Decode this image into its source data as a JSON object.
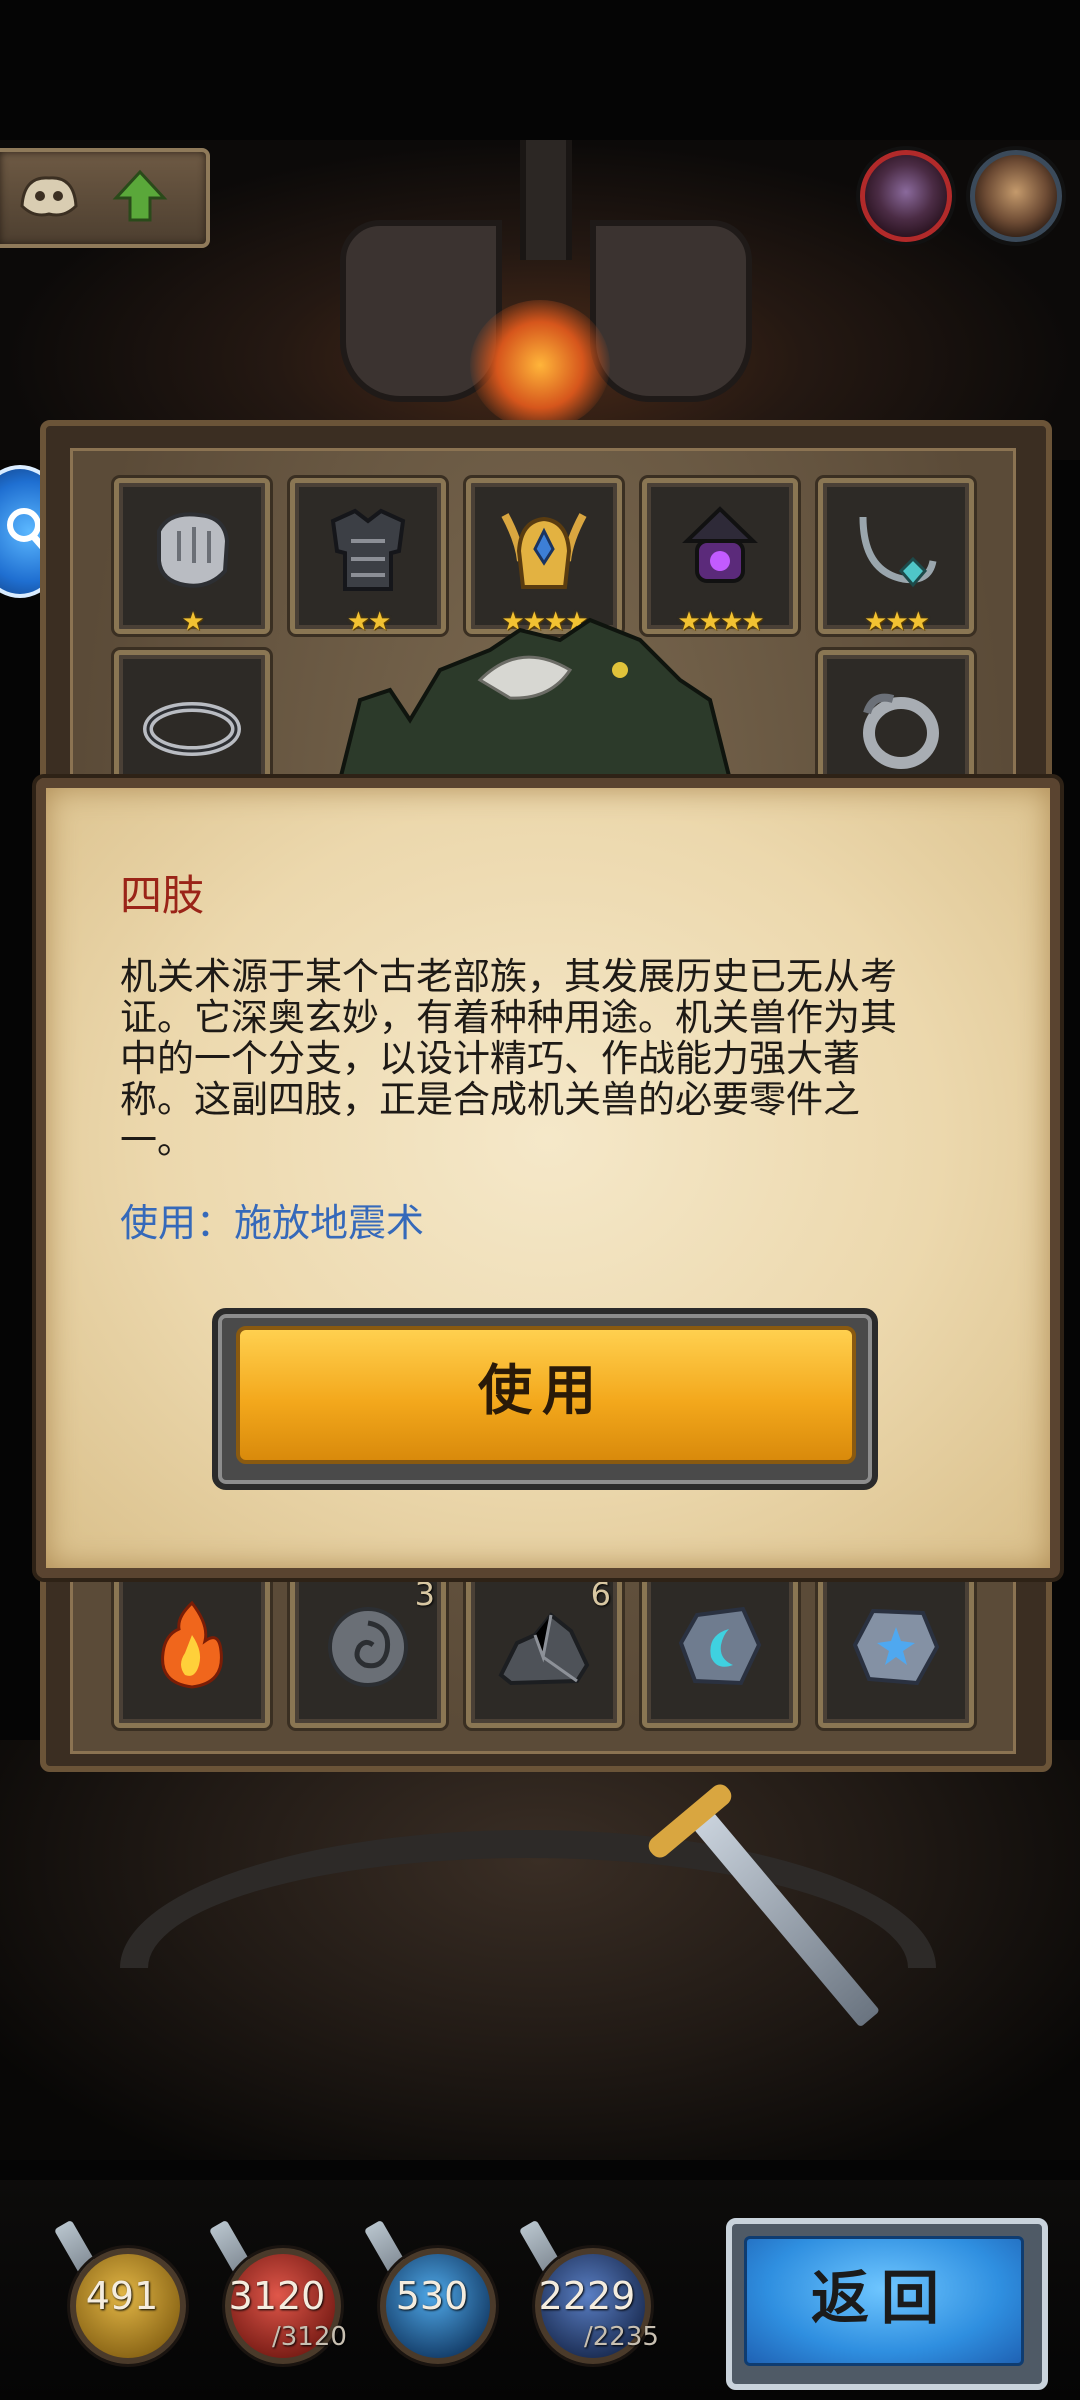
{
  "dialog": {
    "title": "四肢",
    "description": "机关术源于某个古老部族，其发展历史已无从考证。它深奥玄妙，有着种种用途。机关兽作为其中的一个分支，以设计精巧、作战能力强大著称。这副四肢，正是合成机关兽的必要零件之一。",
    "use_text": "使用：施放地震术",
    "use_button": "使用"
  },
  "equipment_row": [
    {
      "icon": "gauntlet-icon",
      "stars": "★"
    },
    {
      "icon": "armor-icon",
      "stars": "★★"
    },
    {
      "icon": "helmet-icon",
      "stars": "★★★★"
    },
    {
      "icon": "lantern-icon",
      "stars": "★★★★"
    },
    {
      "icon": "necklace-icon",
      "stars": "★★★"
    }
  ],
  "equipment_row2": [
    {
      "icon": "bracelet-icon"
    },
    {
      "icon": "ring-icon"
    }
  ],
  "materials_row": [
    {
      "icon": "fire-icon",
      "count": ""
    },
    {
      "icon": "swirl-coin-icon",
      "count": "3"
    },
    {
      "icon": "ore-icon",
      "count": "6"
    },
    {
      "icon": "moon-rune-icon",
      "count": ""
    },
    {
      "icon": "star-rune-icon",
      "count": ""
    }
  ],
  "resources": [
    {
      "value": "491",
      "max": "",
      "color": "#b8891f"
    },
    {
      "value": "3120",
      "max": "/3120",
      "color": "#b43a2e"
    },
    {
      "value": "530",
      "max": "",
      "color": "#2f7bb8"
    },
    {
      "value": "2229",
      "max": "/2235",
      "color": "#3a5f9a"
    }
  ],
  "back_button": "返回",
  "colors": {
    "title_red": "#9a2418",
    "use_blue": "#3569ba",
    "button_gold": "#f3a81c",
    "back_blue": "#2f8fe0"
  }
}
